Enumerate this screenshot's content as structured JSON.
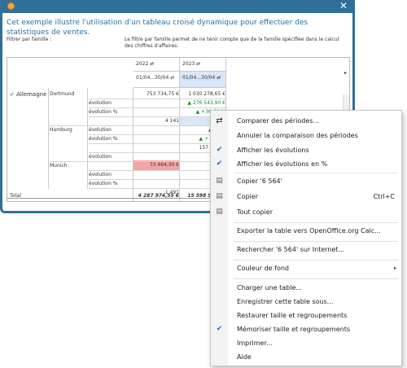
{
  "window": {
    "description": "Cet exemple illustre l'utilisation d'un tableau croisé dynamique pour effectuer des statistiques de ventes.",
    "filter_label": "Filtrer par famille :",
    "filter_help": "Le filtre par famille permet de ne tenir compte que de la famille spécifiée dans le calcul des chiffres d'affaires."
  },
  "grid": {
    "col_headers": [
      {
        "year": "2022 ⇄",
        "period": "01/04...30/04 ⇄"
      },
      {
        "year": "2023 ⇄",
        "period": "01/04...30/04 ⇄"
      }
    ],
    "scroll_arrow": "▸",
    "country": "Allemagne",
    "country_toggle": "✓",
    "total_label": "Total",
    "rows": [
      {
        "city": "Dortmund",
        "measure": "",
        "v1": "753 734,75 €",
        "v2": "1 030 278,65 €"
      },
      {
        "city": "",
        "measure": "évolution",
        "v1": "",
        "v2": "▲   276 543,90 €"
      },
      {
        "city": "",
        "measure": "évolution %",
        "v1": "",
        "v2": "▲   +36,69 %"
      },
      {
        "city": "",
        "measure": "",
        "v1": "4 141",
        "v2": "6 564"
      },
      {
        "city": "Hamburg",
        "measure": "évolution",
        "v1": "",
        "v2": "▲   +2..."
      },
      {
        "city": "",
        "measure": "évolution %",
        "v1": "",
        "v2": "▲   + 58,3..."
      },
      {
        "city": "",
        "measure": "",
        "v1": "",
        "v2": "157 812,..."
      },
      {
        "city": "",
        "measure": "évolution",
        "v1": "",
        "v2": ""
      },
      {
        "city": "Munich",
        "measure": "",
        "v1": "73 464,30 €",
        "v2": "1..."
      },
      {
        "city": "",
        "measure": "évolution",
        "v1": "",
        "v2": "1..."
      },
      {
        "city": "",
        "measure": "évolution %",
        "v1": "",
        "v2": ""
      },
      {
        "city": "",
        "measure": "",
        "v1": "1 491",
        "v2": ""
      }
    ],
    "total_v1": "4 287 974,55 €",
    "total_v2": "15 598 963,..."
  },
  "menu": {
    "items": [
      {
        "label": "Comparer des périodes...",
        "icon": "swap-arrows",
        "glyph": "⇄",
        "shortcut": ""
      },
      {
        "label": "Annuler la comparaison des périodes",
        "icon": "",
        "glyph": "",
        "shortcut": ""
      },
      {
        "label": "Afficher les évolutions",
        "icon": "check",
        "glyph": "✔",
        "shortcut": ""
      },
      {
        "label": "Afficher les évolutions en %",
        "icon": "check",
        "glyph": "✔",
        "shortcut": ""
      },
      {
        "label": "Copier '6 564'",
        "icon": "copy",
        "glyph": "▤",
        "shortcut": ""
      },
      {
        "label": "Copier",
        "icon": "copy",
        "glyph": "▤",
        "shortcut": "Ctrl+C"
      },
      {
        "label": "Tout copier",
        "icon": "copy",
        "glyph": "▤",
        "shortcut": ""
      },
      {
        "label": "Exporter la table vers OpenOffice.org Calc...",
        "icon": "",
        "glyph": "",
        "shortcut": ""
      },
      {
        "label": "Rechercher '6 564' sur Internet...",
        "icon": "",
        "glyph": "",
        "shortcut": ""
      },
      {
        "label": "Couleur de fond",
        "icon": "",
        "glyph": "",
        "shortcut": "",
        "submenu": "▸"
      },
      {
        "label": "Charger une table...",
        "icon": "",
        "glyph": "",
        "shortcut": ""
      },
      {
        "label": "Enregistrer cette table sous...",
        "icon": "",
        "glyph": "",
        "shortcut": ""
      },
      {
        "label": "Restaurer taille et regroupements",
        "icon": "",
        "glyph": "",
        "shortcut": ""
      },
      {
        "label": "Mémoriser taille et regroupements",
        "icon": "check",
        "glyph": "✔",
        "shortcut": ""
      },
      {
        "label": "Imprimer...",
        "icon": "",
        "glyph": "",
        "shortcut": ""
      },
      {
        "label": "Aide",
        "icon": "",
        "glyph": "",
        "shortcut": ""
      }
    ]
  },
  "colors": {
    "accent": "#2f6f9a",
    "check": "#1e66b8",
    "negative_cell": "#f4a3a6",
    "positive_text": "#1e8a2e"
  }
}
